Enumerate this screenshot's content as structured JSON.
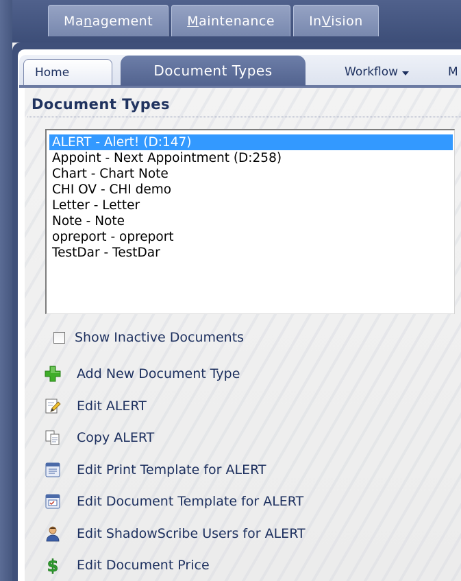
{
  "app_tabs": [
    {
      "pre": "Ma",
      "ul": "n",
      "post": "agement"
    },
    {
      "pre": "",
      "ul": "M",
      "post": "aintenance"
    },
    {
      "pre": "In",
      "ul": "V",
      "post": "ision"
    }
  ],
  "page_tabs": {
    "home": "Home",
    "document_types": "Document Types",
    "workflow": "Workflow",
    "more": "M"
  },
  "section_title": "Document Types",
  "document_list": [
    {
      "label": "ALERT - Alert! (D:147)",
      "selected": true
    },
    {
      "label": "Appoint - Next Appointment (D:258)",
      "selected": false
    },
    {
      "label": "Chart - Chart Note",
      "selected": false
    },
    {
      "label": "CHI OV - CHI demo",
      "selected": false
    },
    {
      "label": "Letter - Letter",
      "selected": false
    },
    {
      "label": "Note - Note",
      "selected": false
    },
    {
      "label": "opreport - opreport",
      "selected": false
    },
    {
      "label": "TestDar - TestDar",
      "selected": false
    }
  ],
  "show_inactive": {
    "label": "Show Inactive Documents",
    "checked": false
  },
  "actions": [
    {
      "icon": "add-icon",
      "label": "Add New Document Type"
    },
    {
      "icon": "edit-document-icon",
      "label": "Edit ALERT"
    },
    {
      "icon": "copy-icon",
      "label": "Copy ALERT"
    },
    {
      "icon": "print-template-icon",
      "label": "Edit Print Template for ALERT"
    },
    {
      "icon": "document-template-icon",
      "label": "Edit Document Template for ALERT"
    },
    {
      "icon": "user-icon",
      "label": "Edit ShadowScribe Users for ALERT"
    },
    {
      "icon": "dollar-icon",
      "label": "Edit Document Price"
    }
  ],
  "colors": {
    "selection": "#3399ff",
    "link_text": "#1c2f5e",
    "frame": "#3f507a",
    "add_icon": "#3fae29",
    "dollar_icon": "#2e9a2e"
  }
}
